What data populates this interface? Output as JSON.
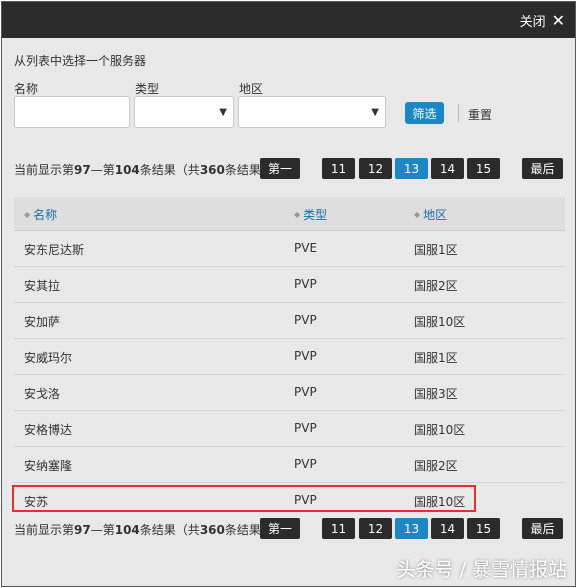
{
  "dialog": {
    "close_label": "关闭",
    "close_icon": "✕"
  },
  "filters": {
    "instruction": "从列表中选择一个服务器",
    "name_label": "名称",
    "name_value": "",
    "type_label": "类型",
    "type_value": "",
    "region_label": "地区",
    "region_value": "",
    "filter_button": "筛选",
    "reset_button": "重置"
  },
  "pagination": {
    "info_prefix": "当前显示第",
    "from": "97",
    "dash": "—第",
    "to": "104",
    "mid": "条结果（共",
    "total": "360",
    "suffix": "条结果）",
    "first_label": "第一",
    "pages": [
      "11",
      "12",
      "13",
      "14",
      "15"
    ],
    "current_page": "13",
    "last_label": "最后"
  },
  "table": {
    "headers": [
      "名称",
      "类型",
      "地区"
    ],
    "rows": [
      {
        "name": "安东尼达斯",
        "type": "PVE",
        "region": "国服1区"
      },
      {
        "name": "安其拉",
        "type": "PVP",
        "region": "国服2区"
      },
      {
        "name": "安加萨",
        "type": "PVP",
        "region": "国服10区"
      },
      {
        "name": "安威玛尔",
        "type": "PVP",
        "region": "国服1区"
      },
      {
        "name": "安戈洛",
        "type": "PVP",
        "region": "国服3区"
      },
      {
        "name": "安格博达",
        "type": "PVP",
        "region": "国服10区"
      },
      {
        "name": "安纳塞隆",
        "type": "PVP",
        "region": "国服2区"
      },
      {
        "name": "安苏",
        "type": "PVP",
        "region": "国服10区"
      }
    ],
    "highlighted_row": 7
  },
  "colors": {
    "accent": "#1b87c4",
    "dark": "#2b2b2b",
    "highlight": "#e03030"
  },
  "watermark": "头条号 / 暴雪情报站"
}
